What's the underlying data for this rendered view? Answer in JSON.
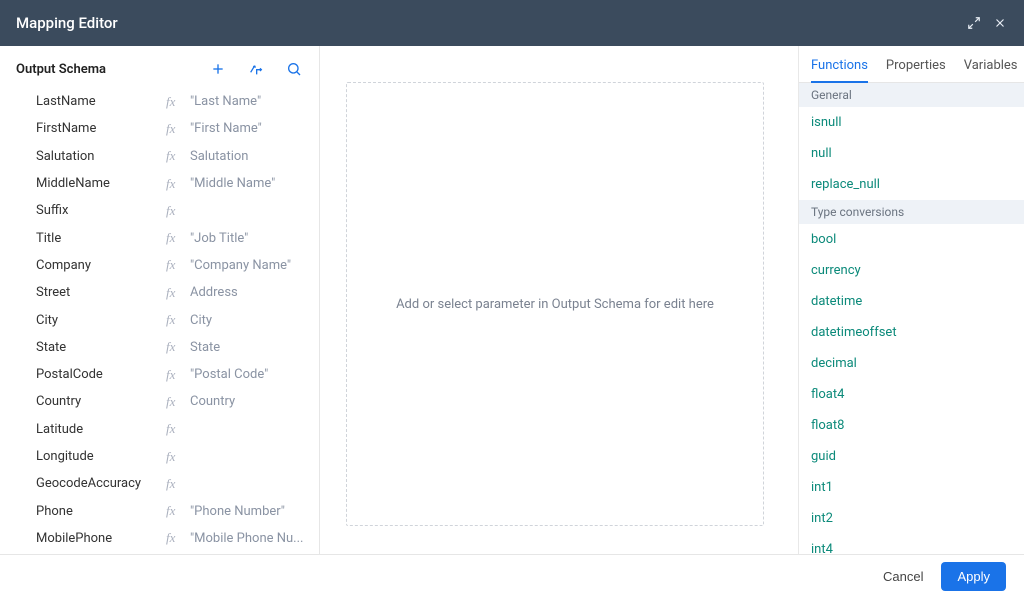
{
  "titlebar": {
    "title": "Mapping Editor"
  },
  "left": {
    "heading": "Output Schema",
    "rows": [
      {
        "name": "LastName",
        "expr": "\"Last Name\""
      },
      {
        "name": "FirstName",
        "expr": "\"First Name\""
      },
      {
        "name": "Salutation",
        "expr": "Salutation"
      },
      {
        "name": "MiddleName",
        "expr": "\"Middle Name\""
      },
      {
        "name": "Suffix",
        "expr": ""
      },
      {
        "name": "Title",
        "expr": "\"Job Title\""
      },
      {
        "name": "Company",
        "expr": "\"Company Name\""
      },
      {
        "name": "Street",
        "expr": "Address"
      },
      {
        "name": "City",
        "expr": "City"
      },
      {
        "name": "State",
        "expr": "State"
      },
      {
        "name": "PostalCode",
        "expr": "\"Postal Code\""
      },
      {
        "name": "Country",
        "expr": "Country"
      },
      {
        "name": "Latitude",
        "expr": ""
      },
      {
        "name": "Longitude",
        "expr": ""
      },
      {
        "name": "GeocodeAccuracy",
        "expr": ""
      },
      {
        "name": "Phone",
        "expr": "\"Phone Number\""
      },
      {
        "name": "MobilePhone",
        "expr": "\"Mobile Phone Nu..."
      }
    ]
  },
  "center": {
    "placeholder": "Add or select parameter in Output Schema for edit here"
  },
  "right": {
    "tabs": [
      "Functions",
      "Properties",
      "Variables"
    ],
    "active_tab": 0,
    "groups": [
      {
        "name": "General",
        "items": [
          "isnull",
          "null",
          "replace_null"
        ]
      },
      {
        "name": "Type conversions",
        "items": [
          "bool",
          "currency",
          "datetime",
          "datetimeoffset",
          "decimal",
          "float4",
          "float8",
          "guid",
          "int1",
          "int2",
          "int4"
        ]
      }
    ]
  },
  "footer": {
    "cancel": "Cancel",
    "apply": "Apply"
  },
  "colors": {
    "accent": "#1a73e8",
    "header": "#3b4b5d",
    "func": "#0c8a7a"
  }
}
